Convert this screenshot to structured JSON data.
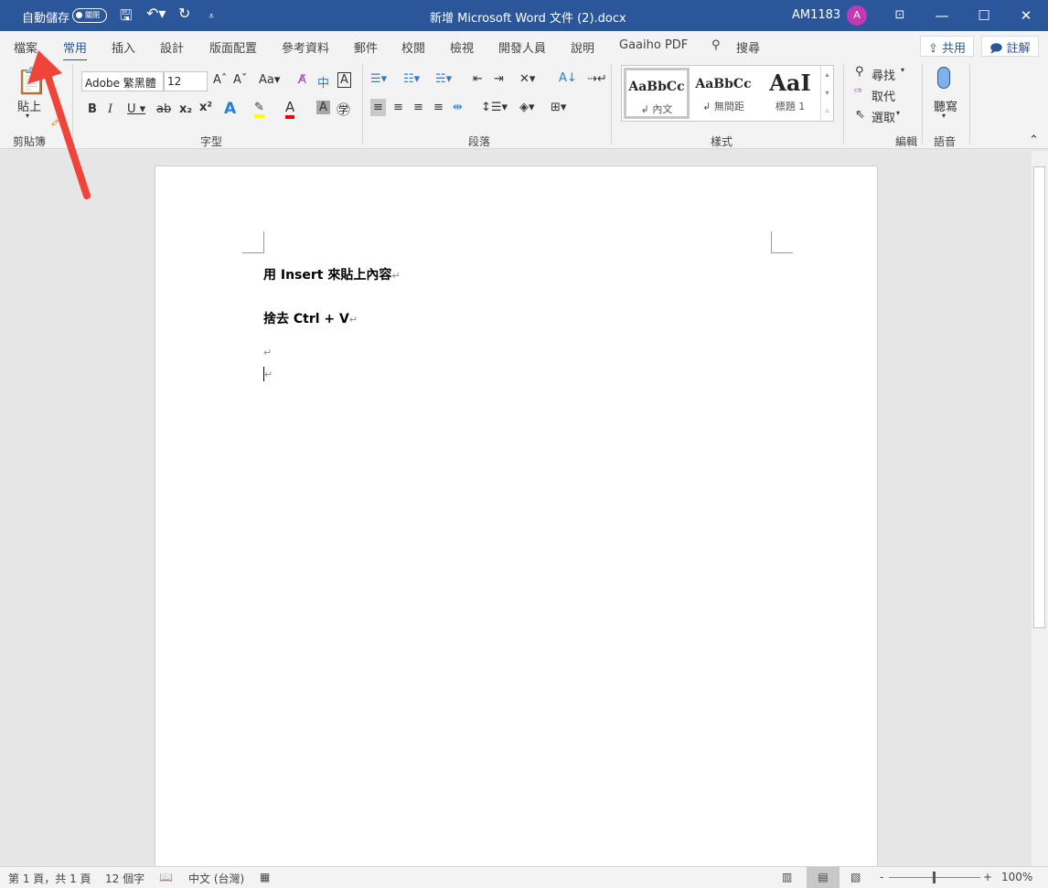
{
  "titlebar": {
    "autosave_label": "自動儲存",
    "autosave_state": "關閉",
    "doc_title": "新增 Microsoft Word 文件 (2).docx",
    "user": "AM1183",
    "avatar_letter": "A",
    "accent": "#2b579a"
  },
  "tabs": [
    {
      "label": "檔案"
    },
    {
      "label": "常用",
      "active": true
    },
    {
      "label": "插入"
    },
    {
      "label": "設計"
    },
    {
      "label": "版面配置"
    },
    {
      "label": "參考資料"
    },
    {
      "label": "郵件"
    },
    {
      "label": "校閱"
    },
    {
      "label": "檢視"
    },
    {
      "label": "開發人員"
    },
    {
      "label": "說明"
    },
    {
      "label": "Gaaiho PDF"
    }
  ],
  "search_label": "搜尋",
  "share_label": "共用",
  "comment_label": "註解",
  "ribbon": {
    "clipboard": {
      "paste": "貼上",
      "label": "剪貼簿"
    },
    "font": {
      "name": "Adobe 繁黑體",
      "size": "12",
      "label": "字型"
    },
    "paragraph": {
      "label": "段落"
    },
    "styles": {
      "label": "樣式",
      "items": [
        {
          "preview": "AaBbCc",
          "name": "↲ 內文"
        },
        {
          "preview": "AaBbCc",
          "name": "↲ 無間距"
        },
        {
          "preview": "AaI",
          "name": "標題 1"
        }
      ]
    },
    "editing": {
      "find": "尋找",
      "replace": "取代",
      "select": "選取",
      "label": "編輯"
    },
    "voice": {
      "dictate": "聽寫",
      "label": "語音"
    }
  },
  "document": {
    "paragraphs": [
      "用 Insert 來貼上內容",
      "捨去 Ctrl + V"
    ],
    "mark": "↵"
  },
  "status": {
    "page": "第 1 頁，共 1 頁",
    "words": "12 個字",
    "language": "中文 (台灣)",
    "zoom": "100%",
    "zoom_value": 100
  }
}
